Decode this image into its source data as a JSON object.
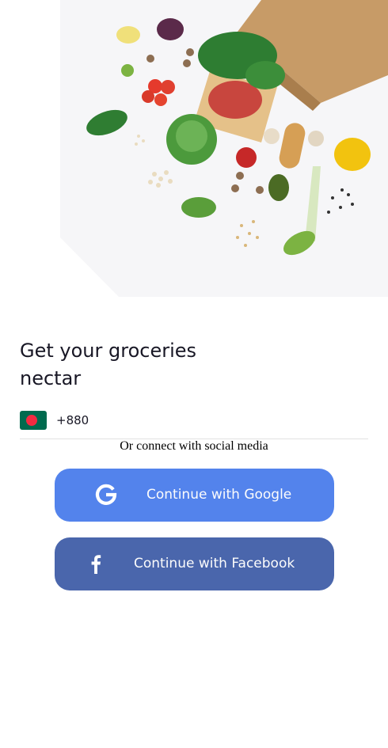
{
  "hero": {
    "image": "groceries-flatlay"
  },
  "heading": {
    "line1": "Get your groceries",
    "line2": "nectar"
  },
  "phone": {
    "flag": "bangladesh-flag",
    "country_code": "+880"
  },
  "social": {
    "label": "Or connect with social media",
    "google": {
      "label": "Continue with Google",
      "icon": "google-icon",
      "color": "#5383EC"
    },
    "facebook": {
      "label": "Continue with Facebook",
      "icon": "facebook-icon",
      "color": "#4A66AC"
    }
  }
}
